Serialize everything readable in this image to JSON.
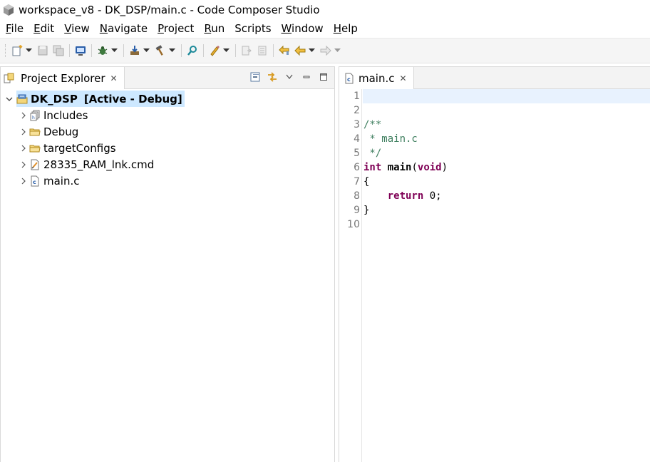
{
  "window": {
    "title": "workspace_v8 - DK_DSP/main.c - Code Composer Studio"
  },
  "menu": [
    {
      "label": "File",
      "mnemonic": "F",
      "rest": "ile"
    },
    {
      "label": "Edit",
      "mnemonic": "E",
      "rest": "dit"
    },
    {
      "label": "View",
      "mnemonic": "V",
      "rest": "iew"
    },
    {
      "label": "Navigate",
      "mnemonic": "N",
      "rest": "avigate"
    },
    {
      "label": "Project",
      "mnemonic": "P",
      "rest": "roject"
    },
    {
      "label": "Run",
      "mnemonic": "R",
      "rest": "un"
    },
    {
      "label": "Scripts",
      "mnemonic": "",
      "rest": "Scripts"
    },
    {
      "label": "Window",
      "mnemonic": "W",
      "rest": "indow"
    },
    {
      "label": "Help",
      "mnemonic": "H",
      "rest": "elp"
    }
  ],
  "explorer": {
    "tab_label": "Project Explorer",
    "close_glyph": "✕",
    "project": {
      "name": "DK_DSP",
      "status": "[Active - Debug]",
      "children": [
        {
          "label": "Includes",
          "icon": "includes-icon"
        },
        {
          "label": "Debug",
          "icon": "folder-icon"
        },
        {
          "label": "targetConfigs",
          "icon": "folder-icon"
        },
        {
          "label": "28335_RAM_lnk.cmd",
          "icon": "cmd-file-icon"
        },
        {
          "label": "main.c",
          "icon": "c-file-icon"
        }
      ]
    }
  },
  "editor": {
    "tab_label": "main.c",
    "close_glyph": "✕",
    "line_numbers": [
      "1",
      "2",
      "3",
      "4",
      "5",
      "6",
      "7",
      "8",
      "9",
      "10"
    ],
    "code": {
      "l3": "/**",
      "l4": " * main.c",
      "l5": " */",
      "l6_kw": "int",
      "l6_fn": "main",
      "l6_open": "(",
      "l6_arg": "void",
      "l6_close": ")",
      "l7": "{",
      "l8_indent": "    ",
      "l8_kw": "return",
      "l8_rest": " 0;",
      "l9": "}"
    }
  },
  "colors": {
    "selection": "#cde8ff",
    "keyword": "#7f0055",
    "comment": "#3f7f5f",
    "current_line": "#e8f2fe"
  }
}
